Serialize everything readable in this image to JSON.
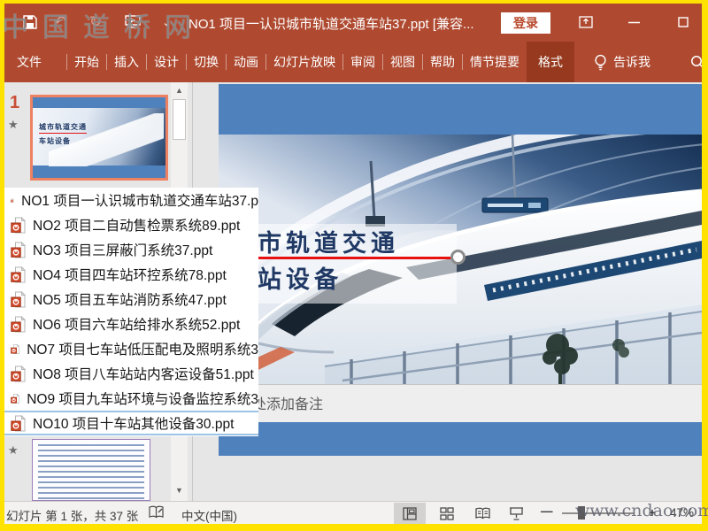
{
  "watermarks": {
    "top_left": "中国道桥网",
    "bottom_right": "www.cndao.com"
  },
  "title_bar": {
    "title": "NO1  项目一认识城市轨道交通车站37.ppt [兼容...",
    "login": "登录"
  },
  "ribbon": {
    "tabs": [
      "文件",
      "开始",
      "插入",
      "设计",
      "切换",
      "动画",
      "幻灯片放映",
      "审阅",
      "视图",
      "帮助",
      "情节提要",
      "格式"
    ],
    "active_index": 11,
    "tell_me": "告诉我"
  },
  "panel": {
    "slide1_number": "1",
    "star": "★",
    "up_arrow": "▲",
    "down_arrow": "▼"
  },
  "file_list": {
    "items": [
      "NO1  项目一认识城市轨道交通车站37.p",
      "NO2  项目二自动售检票系统89.ppt",
      "NO3  项目三屏蔽门系统37.ppt",
      "NO4  项目四车站环控系统78.ppt",
      "NO5  项目五车站消防系统47.ppt",
      "NO6  项目六车站给排水系统52.ppt",
      "NO7  项目七车站低压配电及照明系统3",
      "NO8  项目八车站站内客运设备51.ppt",
      "NO9  项目九车站环境与设备监控系统3",
      "NO10  项目十车站其他设备30.ppt"
    ],
    "highlight_index": 9
  },
  "slide": {
    "thumb_title_line1": "城市轨道交通",
    "thumb_title_line2": "车站设备",
    "title_line1": "市轨道交通",
    "title_line2": "站设备"
  },
  "notes": {
    "placeholder": "单击此处添加备注"
  },
  "status_bar": {
    "slide_info": "幻灯片 第 1 张，共 37 张",
    "language": "中文(中国)",
    "zoom_minus": "—",
    "zoom_plus": "+",
    "zoom_level": "47%"
  },
  "colors": {
    "titlebar_red": "#AF4A31",
    "active_tab_red": "#96391F",
    "accent_blue": "#4F81BD",
    "thumb_select_orange": "#ED8162",
    "red_line": "#E81111",
    "frame_yellow": "#FFE200",
    "highlight_blue": "#9DC3E6"
  }
}
